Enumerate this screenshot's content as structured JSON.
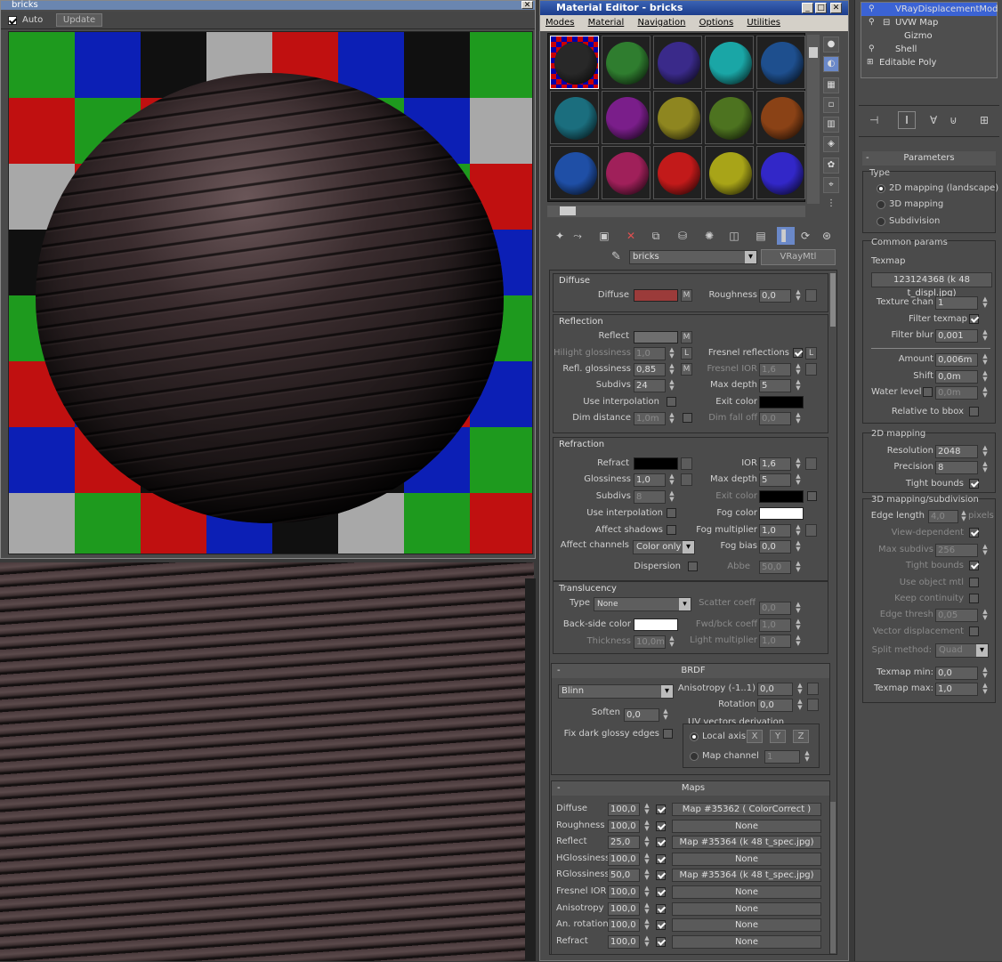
{
  "render_window": {
    "title": "bricks",
    "auto_label": "Auto",
    "update_label": "Update"
  },
  "material_editor": {
    "title": "Material Editor - bricks",
    "menu": [
      "Modes",
      "Material",
      "Navigation",
      "Options",
      "Utilities"
    ],
    "material_name": "bricks",
    "material_type": "VRayMtl",
    "slot_colors": [
      "#282828",
      "#2f7d2f",
      "#3a2a8a",
      "#1aa6a6",
      "#1e4f8e",
      "#1b6e7e",
      "#7a1e8a",
      "#8e8620",
      "#4d7320",
      "#8a4216",
      "#1f4fa6",
      "#a0205a",
      "#c21a1a",
      "#a8a418",
      "#3227c8"
    ],
    "diffuse": {
      "header": "Diffuse",
      "diffuse_label": "Diffuse",
      "diffuse_color": "#9b3b3a",
      "m_label": "M",
      "roughness_label": "Roughness",
      "roughness_value": "0,0"
    },
    "reflection": {
      "header": "Reflection",
      "reflect_label": "Reflect",
      "reflect_color": "#6e6e6e",
      "hilight_label": "Hilight glossiness",
      "hilight_value": "1,0",
      "l_label": "L",
      "fresnel_label": "Fresnel reflections",
      "refl_gloss_label": "Refl. glossiness",
      "refl_gloss_value": "0,85",
      "fresnel_ior_label": "Fresnel IOR",
      "fresnel_ior_value": "1,6",
      "subdivs_label": "Subdivs",
      "subdivs_value": "24",
      "max_depth_label": "Max depth",
      "max_depth_value": "5",
      "use_interp_label": "Use interpolation",
      "exit_color_label": "Exit color",
      "dim_distance_label": "Dim distance",
      "dim_distance_value": "1,0m",
      "dim_falloff_label": "Dim fall off",
      "dim_falloff_value": "0,0"
    },
    "refraction": {
      "header": "Refraction",
      "refract_label": "Refract",
      "ior_label": "IOR",
      "ior_value": "1,6",
      "glossiness_label": "Glossiness",
      "glossiness_value": "1,0",
      "max_depth_label": "Max depth",
      "max_depth_value": "5",
      "subdivs_label": "Subdivs",
      "subdivs_value": "8",
      "exit_color_label": "Exit color",
      "use_interp_label": "Use interpolation",
      "fog_color_label": "Fog color",
      "affect_shadows_label": "Affect shadows",
      "fog_mult_label": "Fog multiplier",
      "fog_mult_value": "1,0",
      "affect_channels_label": "Affect channels",
      "affect_channels_value": "Color only",
      "fog_bias_label": "Fog bias",
      "fog_bias_value": "0,0",
      "dispersion_label": "Dispersion",
      "abbe_label": "Abbe",
      "abbe_value": "50,0"
    },
    "translucency": {
      "header": "Translucency",
      "type_label": "Type",
      "type_value": "None",
      "scatter_label": "Scatter coeff",
      "scatter_value": "0,0",
      "backside_label": "Back-side color",
      "fwd_label": "Fwd/bck coeff",
      "fwd_value": "1,0",
      "thickness_label": "Thickness",
      "thickness_value": "10,0m",
      "light_mult_label": "Light multiplier",
      "light_mult_value": "1,0"
    },
    "brdf": {
      "header": "BRDF",
      "collapse": "-",
      "type_value": "Blinn",
      "aniso_label": "Anisotropy (-1..1)",
      "aniso_value": "0,0",
      "rotation_label": "Rotation",
      "rotation_value": "0,0",
      "soften_label": "Soften",
      "soften_value": "0,0",
      "uv_label": "UV vectors derivation",
      "fix_dark_label": "Fix dark glossy edges",
      "local_axis_label": "Local axis",
      "x_label": "X",
      "y_label": "Y",
      "z_label": "Z",
      "map_channel_label": "Map channel",
      "map_channel_value": "1"
    },
    "maps": {
      "header": "Maps",
      "collapse": "-",
      "rows": [
        {
          "label": "Diffuse",
          "amount": "100,0",
          "map": "Map #35362  ( ColorCorrect )"
        },
        {
          "label": "Roughness",
          "amount": "100,0",
          "map": "None"
        },
        {
          "label": "Reflect",
          "amount": "25,0",
          "map": "Map #35364 (k 48 t_spec.jpg)"
        },
        {
          "label": "HGlossiness",
          "amount": "100,0",
          "map": "None"
        },
        {
          "label": "RGlossiness",
          "amount": "50,0",
          "map": "Map #35364 (k 48 t_spec.jpg)"
        },
        {
          "label": "Fresnel IOR",
          "amount": "100,0",
          "map": "None"
        },
        {
          "label": "Anisotropy",
          "amount": "100,0",
          "map": "None"
        },
        {
          "label": "An. rotation",
          "amount": "100,0",
          "map": "None"
        },
        {
          "label": "Refract",
          "amount": "100,0",
          "map": "None"
        }
      ]
    }
  },
  "command_panel": {
    "stack": [
      "VRayDisplacementMod",
      "UVW Map",
      "Gizmo",
      "Shell",
      "Editable Poly"
    ],
    "params_header": "Parameters",
    "type_label": "Type",
    "type_options": [
      "2D mapping (landscape)",
      "3D mapping",
      "Subdivision"
    ],
    "common_label": "Common params",
    "texmap_label": "Texmap",
    "texmap_value": "123124368 (k 48 t_displ.jpg)",
    "texture_chan_label": "Texture chan",
    "texture_chan_value": "1",
    "filter_texmap_label": "Filter texmap",
    "filter_blur_label": "Filter blur",
    "filter_blur_value": "0,001",
    "amount_label": "Amount",
    "amount_value": "0,006m",
    "shift_label": "Shift",
    "shift_value": "0,0m",
    "water_label": "Water level",
    "water_value": "0,0m",
    "rel_bbox_label": "Relative to bbox",
    "map2d_label": "2D mapping",
    "resolution_label": "Resolution",
    "resolution_value": "2048",
    "precision_label": "Precision",
    "precision_value": "8",
    "tight_bounds_label": "Tight bounds",
    "map3d_label": "3D mapping/subdivision",
    "edge_length_label": "Edge length",
    "edge_length_value": "4,0",
    "pixels_label": "pixels",
    "view_dep_label": "View-dependent",
    "max_subdivs_label": "Max subdivs",
    "max_subdivs_value": "256",
    "tight_bounds2_label": "Tight bounds",
    "use_object_label": "Use object mtl",
    "keep_cont_label": "Keep continuity",
    "edge_thresh_label": "Edge thresh",
    "edge_thresh_value": "0,05",
    "vector_disp_label": "Vector displacement",
    "split_label": "Split method:",
    "split_value": "Quad",
    "texmap_min_label": "Texmap min:",
    "texmap_min_value": "0,0",
    "texmap_max_label": "Texmap max:",
    "texmap_max_value": "1,0"
  }
}
